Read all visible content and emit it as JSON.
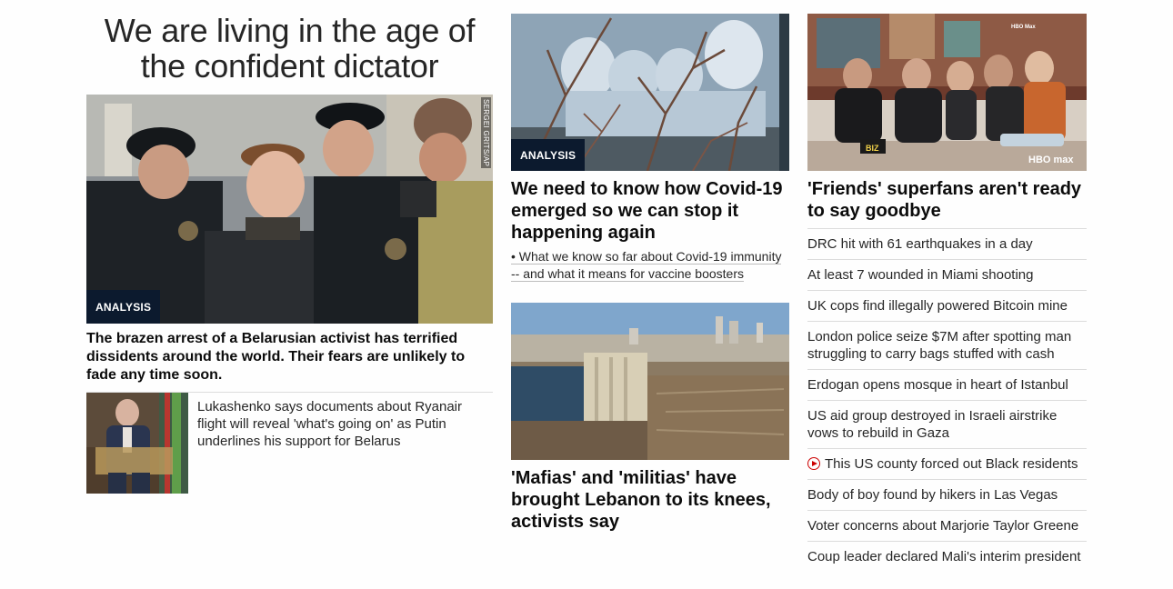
{
  "column1": {
    "title": "We are living in the age of the confident dictator",
    "lead_image": {
      "alt": "Police officers detaining a young man in a crowd",
      "badge": "ANALYSIS",
      "credit": "SERGEI GRITS/AP"
    },
    "lead_text": "The brazen arrest of a Belarusian activist has terrified dissidents around the world. Their fears are unlikely to fade any time soon.",
    "small_story": {
      "image_alt": "Man in a suit seated in a chair in front of a flag",
      "text": "Lukashenko says documents about Ryanair flight will reveal 'what's going on' as Putin underlines his support for Belarus"
    }
  },
  "column2": {
    "story1": {
      "image_alt": "Workers in white protective suits seen through a window and branches",
      "badge": "ANALYSIS",
      "headline": "We need to know how Covid-19 emerged so we can stop it happening again",
      "link": "• What we know so far about Covid-19 immunity -- and what it means for vaccine boosters"
    },
    "story2": {
      "image_alt": "Aerial view of a damaged grain silo and port with a city skyline",
      "headline": "'Mafias' and 'militias' have brought Lebanon to its knees, activists say"
    }
  },
  "column3": {
    "lead": {
      "image_alt": "Group of people seated on a couch on a TV set",
      "watermark": "HBO max",
      "corner_tag": "HBO Max",
      "sign": "BIZ",
      "headline": "'Friends' superfans aren't ready to say goodbye"
    },
    "items": [
      {
        "text": "DRC hit with 61 earthquakes in a day",
        "video": false
      },
      {
        "text": "At least 7 wounded in Miami shooting",
        "video": false
      },
      {
        "text": "UK cops find illegally powered Bitcoin mine",
        "video": false
      },
      {
        "text": "London police seize $7M after spotting man struggling to carry bags stuffed with cash",
        "video": false
      },
      {
        "text": "Erdogan opens mosque in heart of Istanbul",
        "video": false
      },
      {
        "text": "US aid group destroyed in Israeli airstrike vows to rebuild in Gaza",
        "video": false
      },
      {
        "text": "This US county forced out Black residents",
        "video": true
      },
      {
        "text": "Body of boy found by hikers in Las Vegas",
        "video": false
      },
      {
        "text": "Voter concerns about Marjorie Taylor Greene",
        "video": false
      },
      {
        "text": "Coup leader declared Mali's interim president",
        "video": false
      }
    ]
  },
  "colors": {
    "badge_bg": "#0c1a2e",
    "video_icon": "#cc0000",
    "divider": "#dcdcdc"
  }
}
